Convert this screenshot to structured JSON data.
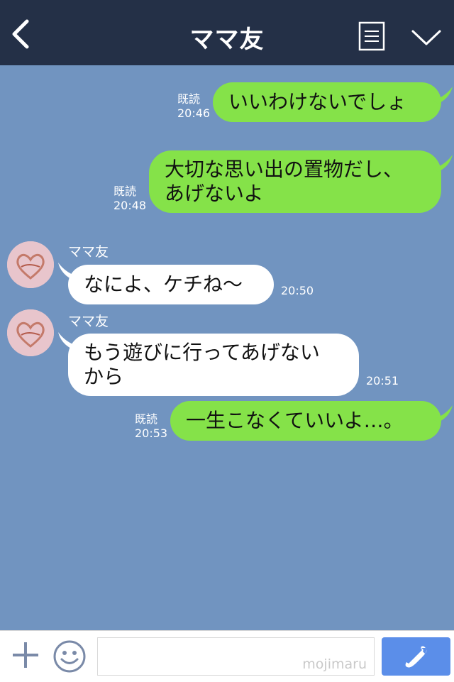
{
  "header": {
    "title": "ママ友"
  },
  "messages": [
    {
      "side": "right",
      "text": "いいわけないでしょ",
      "read": "既読",
      "time": "20:46"
    },
    {
      "side": "right",
      "text_line1": "大切な思い出の置物だし、",
      "text_line2": "あげないよ",
      "read": "既読",
      "time": "20:48"
    },
    {
      "side": "left",
      "sender": "ママ友",
      "text": "なによ、ケチね〜",
      "time": "20:50"
    },
    {
      "side": "left",
      "sender": "ママ友",
      "text_line1": "もう遊びに行ってあげない",
      "text_line2": "から",
      "time": "20:51"
    },
    {
      "side": "right",
      "text": "一生こなくていいよ…。",
      "read": "既読",
      "time": "20:53"
    }
  ],
  "footer": {
    "watermark": "mojimaru"
  },
  "colors": {
    "header_bg": "#243047",
    "chat_bg": "#7194c0",
    "green_bubble": "#85e249",
    "call_button": "#5b8ee9"
  },
  "icons": [
    "chevron-left-icon",
    "note-icon",
    "chevron-down-icon",
    "plus-icon",
    "smiley-icon",
    "phone-icon"
  ]
}
